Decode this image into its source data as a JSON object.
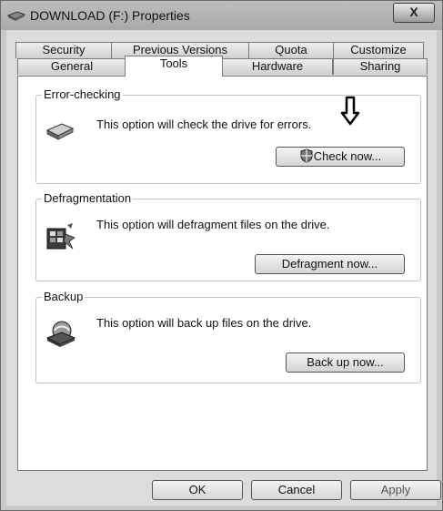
{
  "window": {
    "title": "DOWNLOAD (F:) Properties",
    "close_label": "X"
  },
  "tabs": {
    "top_row": [
      "Security",
      "Previous Versions",
      "Quota",
      "Customize"
    ],
    "bottom_row": [
      "General",
      "Tools",
      "Hardware",
      "Sharing"
    ],
    "active": "Tools"
  },
  "sections": {
    "error_checking": {
      "title": "Error-checking",
      "description": "This option will check the drive for errors.",
      "button": "Check now...",
      "icon": "hard-drive-icon"
    },
    "defragmentation": {
      "title": "Defragmentation",
      "description": "This option will defragment files on the drive.",
      "button": "Defragment now...",
      "icon": "defragment-icon"
    },
    "backup": {
      "title": "Backup",
      "description": "This option will back up files on the drive.",
      "button": "Back up now...",
      "icon": "backup-icon"
    }
  },
  "footer": {
    "ok": "OK",
    "cancel": "Cancel",
    "apply": "Apply"
  },
  "colors": {
    "titlebar": "#b3b3b3",
    "dialog": "#dcdcdc",
    "panel": "#ffffff"
  }
}
